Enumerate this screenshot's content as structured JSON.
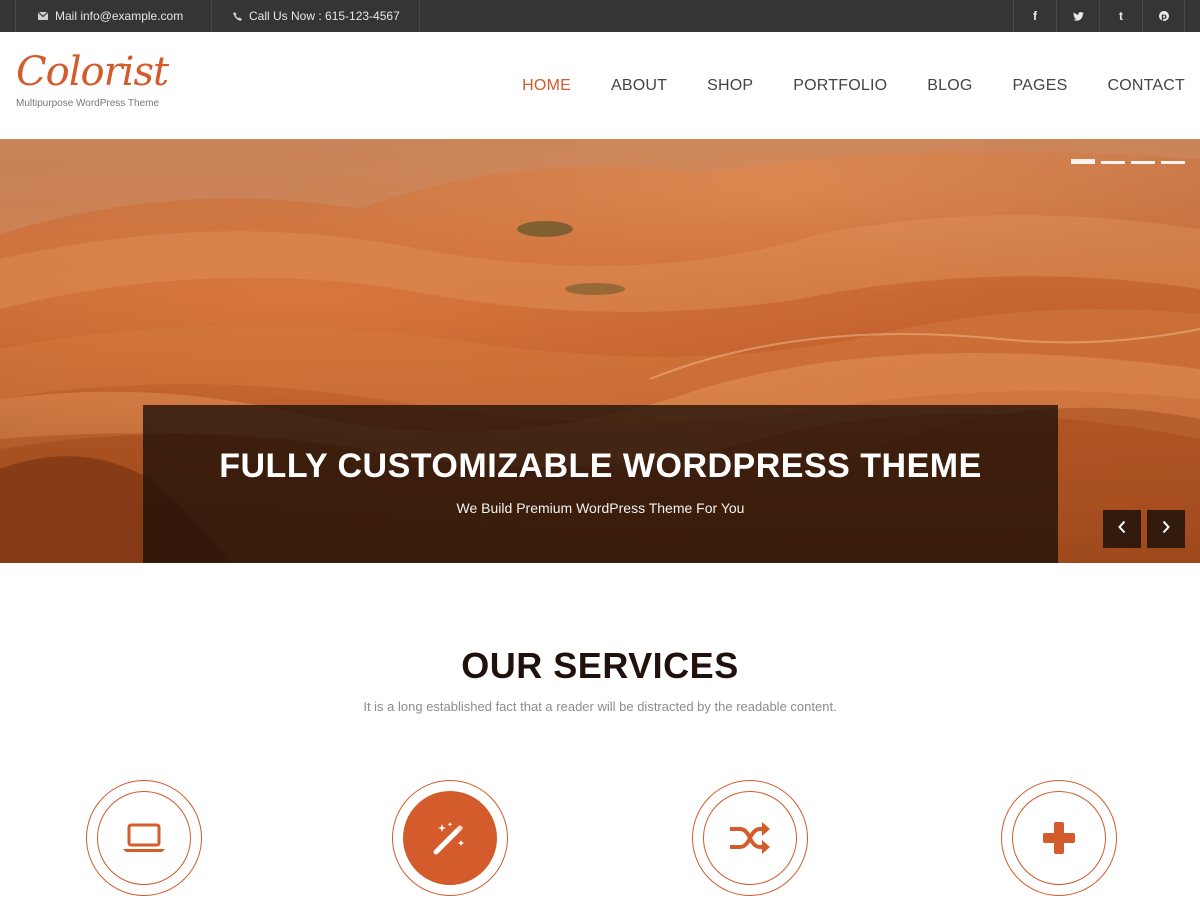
{
  "topbar": {
    "mail_text": "Mail info@example.com",
    "phone_text": "Call Us Now : 615-123-4567",
    "social": [
      {
        "icon": "facebook-icon",
        "glyph": "f"
      },
      {
        "icon": "twitter-icon",
        "glyph": "t"
      },
      {
        "icon": "tumblr-icon",
        "glyph": "t"
      },
      {
        "icon": "pinterest-icon",
        "glyph": "p"
      }
    ]
  },
  "header": {
    "logo_text": "Colorist",
    "logo_tagline": "Multipurpose WordPress Theme",
    "nav": [
      {
        "label": "HOME",
        "active": true
      },
      {
        "label": "ABOUT",
        "active": false
      },
      {
        "label": "SHOP",
        "active": false
      },
      {
        "label": "PORTFOLIO",
        "active": false
      },
      {
        "label": "BLOG",
        "active": false
      },
      {
        "label": "PAGES",
        "active": false
      },
      {
        "label": "CONTACT",
        "active": false
      }
    ]
  },
  "hero": {
    "title": "FULLY CUSTOMIZABLE WORDPRESS THEME",
    "subtitle": "We Build Premium WordPress Theme For You",
    "slides_count": 4,
    "active_slide": 1
  },
  "services": {
    "title": "OUR SERVICES",
    "description": "It is a long established fact that a reader will be distracted by the readable content.",
    "icons": [
      "laptop-icon",
      "magic-wand-icon",
      "shuffle-icon",
      "plus-icon"
    ]
  },
  "colors": {
    "accent": "#d35b2c",
    "topbar_bg": "#353535",
    "heading": "#21110c"
  }
}
